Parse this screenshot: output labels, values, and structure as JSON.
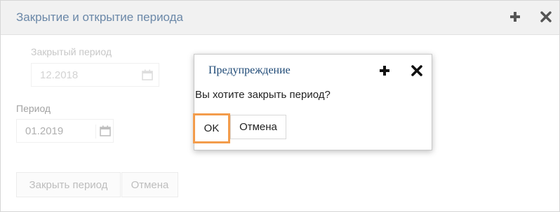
{
  "window": {
    "title": "Закрытие и открытие периода",
    "add_icon": "plus-icon",
    "close_icon": "close-icon"
  },
  "form": {
    "closed_period_label": "Закрытый период",
    "closed_period_value": "12.2018",
    "period_label": "Период",
    "period_value": "01.2019",
    "calendar_icon": "calendar-icon",
    "close_period_button": "Закрыть период",
    "cancel_button": "Отмена"
  },
  "dialog": {
    "title": "Предупреждение",
    "message": "Вы хотите закрыть период?",
    "ok_button": "OK",
    "cancel_button": "Отмена",
    "add_icon": "plus-icon",
    "close_icon": "close-icon"
  },
  "colors": {
    "window_title": "#6b88a8",
    "dialog_title": "#1e4976",
    "ok_highlight": "#f39c4b"
  }
}
